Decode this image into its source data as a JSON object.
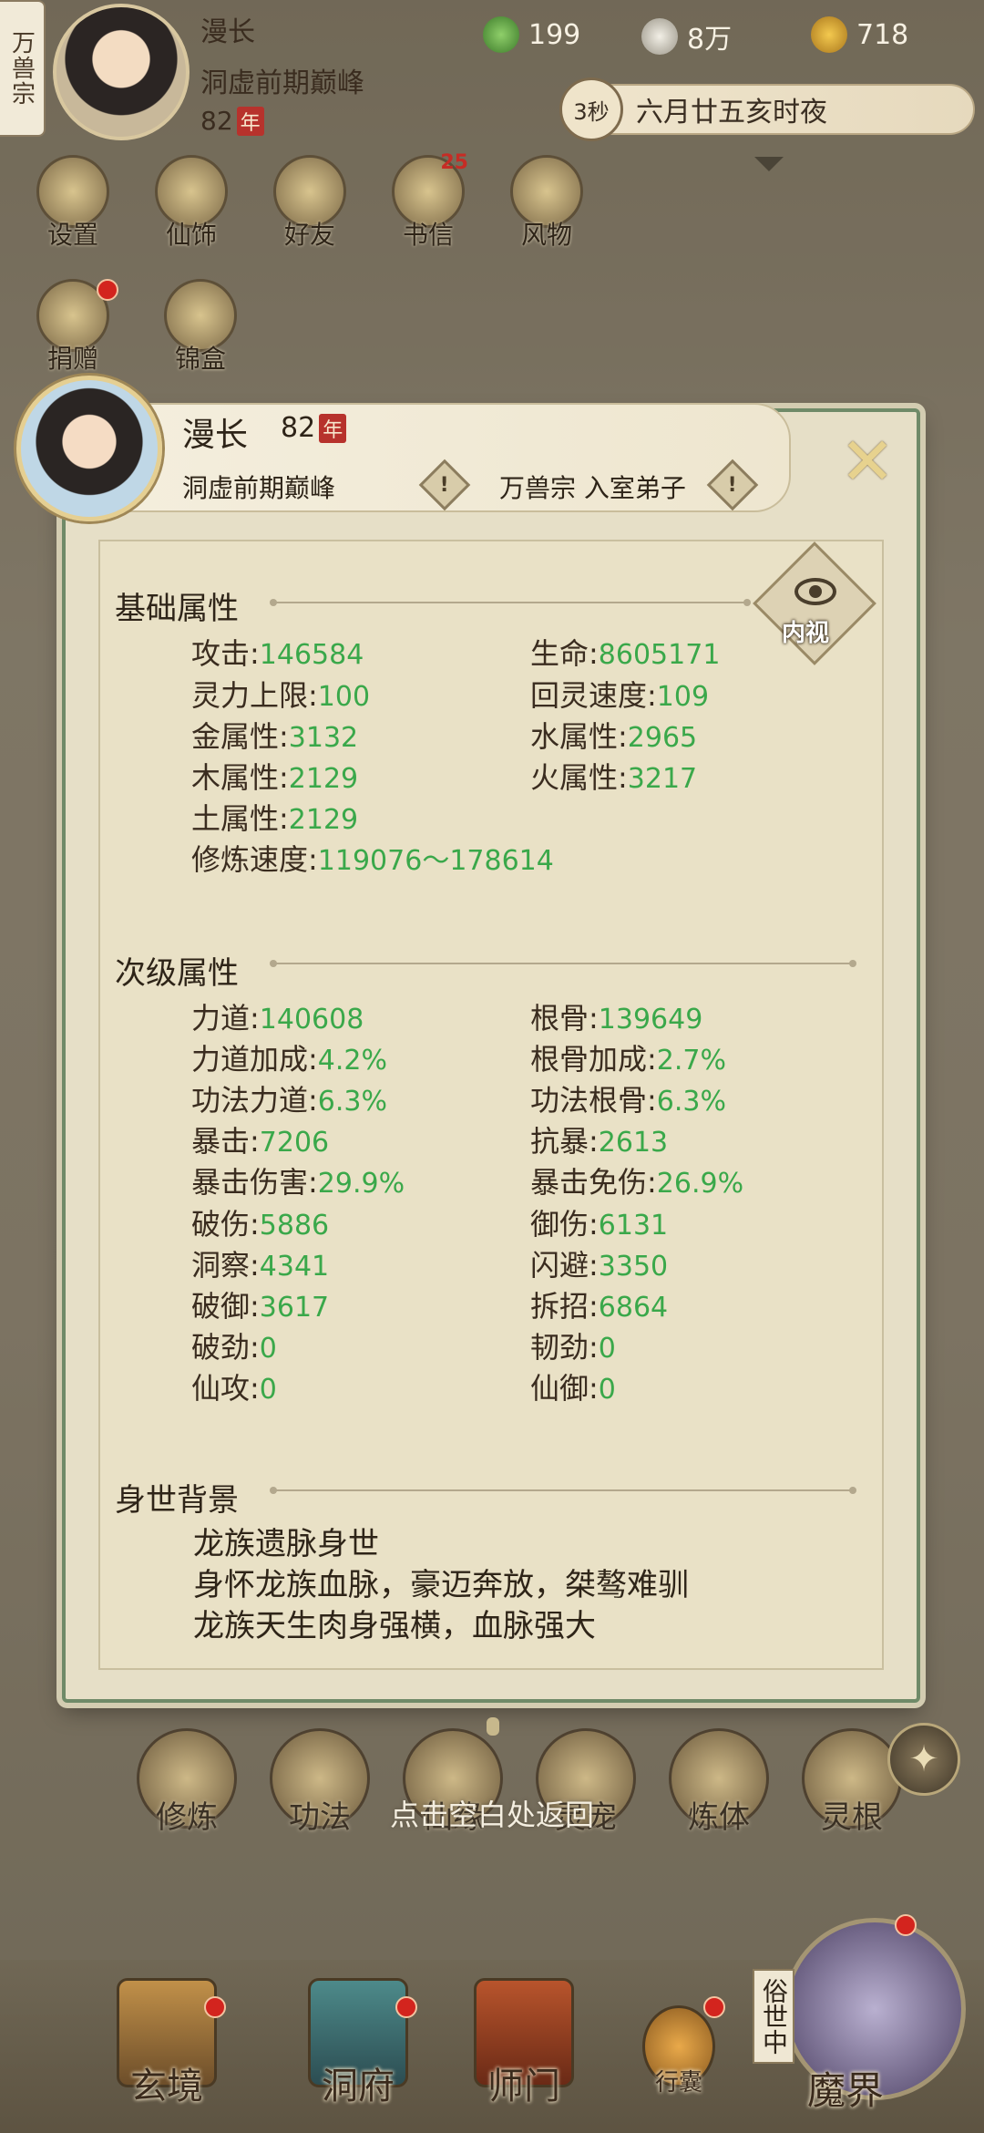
{
  "top": {
    "sect_tab": "万兽宗",
    "player_name": "漫长",
    "realm": "洞虚前期巅峰",
    "age": "82",
    "age_unit": "年",
    "resources": [
      {
        "icon": "leaf-icon",
        "value": "199"
      },
      {
        "icon": "coin-icon",
        "value": "8万"
      },
      {
        "icon": "strength-icon",
        "value": "718"
      }
    ],
    "timer_seconds": "3秒",
    "date_text": "六月廿五亥时夜"
  },
  "quick_menu": [
    {
      "label": "设置",
      "icon": "gear-icon"
    },
    {
      "label": "仙饰",
      "icon": "ornament-icon"
    },
    {
      "label": "好友",
      "icon": "friends-icon"
    },
    {
      "label": "书信",
      "icon": "letter-icon",
      "badge": "25"
    },
    {
      "label": "风物",
      "icon": "scenery-icon"
    }
  ],
  "quick_menu2": [
    {
      "label": "捐赠",
      "icon": "donate-icon"
    },
    {
      "label": "锦盒",
      "icon": "gift-box-icon"
    }
  ],
  "panel": {
    "name": "漫长",
    "age": "82",
    "age_unit": "年",
    "realm": "洞虚前期巅峰",
    "sect_role": "万兽宗 入室弟子",
    "inner_view_label": "内视",
    "basic_title": "基础属性",
    "basic": [
      {
        "label": "攻击",
        "value": "146584"
      },
      {
        "label": "生命",
        "value": "8605171"
      },
      {
        "label": "灵力上限",
        "value": "100"
      },
      {
        "label": "回灵速度",
        "value": "109"
      },
      {
        "label": "金属性",
        "value": "3132"
      },
      {
        "label": "水属性",
        "value": "2965"
      },
      {
        "label": "木属性",
        "value": "2129"
      },
      {
        "label": "火属性",
        "value": "3217"
      },
      {
        "label": "土属性",
        "value": "2129"
      },
      {
        "label": "修炼速度",
        "value": "119076～178614"
      }
    ],
    "secondary_title": "次级属性",
    "secondary": [
      {
        "label": "力道",
        "value": "140608"
      },
      {
        "label": "根骨",
        "value": "139649"
      },
      {
        "label": "力道加成",
        "value": "4.2%"
      },
      {
        "label": "根骨加成",
        "value": "2.7%"
      },
      {
        "label": "功法力道",
        "value": "6.3%"
      },
      {
        "label": "功法根骨",
        "value": "6.3%"
      },
      {
        "label": "暴击",
        "value": "7206"
      },
      {
        "label": "抗暴",
        "value": "2613"
      },
      {
        "label": "暴击伤害",
        "value": "29.9%"
      },
      {
        "label": "暴击免伤",
        "value": "26.9%"
      },
      {
        "label": "破伤",
        "value": "5886"
      },
      {
        "label": "御伤",
        "value": "6131"
      },
      {
        "label": "洞察",
        "value": "4341"
      },
      {
        "label": "闪避",
        "value": "3350"
      },
      {
        "label": "破御",
        "value": "3617"
      },
      {
        "label": "拆招",
        "value": "6864"
      },
      {
        "label": "破劲",
        "value": "0"
      },
      {
        "label": "韧劲",
        "value": "0"
      },
      {
        "label": "仙攻",
        "value": "0"
      },
      {
        "label": "仙御",
        "value": "0"
      }
    ],
    "background_title": "身世背景",
    "background_lines": [
      "龙族遗脉身世",
      "身怀龙族血脉，豪迈奔放，桀骜难驯",
      "龙族天生肉身强横，血脉强大"
    ]
  },
  "bottom_menu": [
    "修炼",
    "功法",
    "仙缘",
    "灵宠",
    "炼体",
    "灵根"
  ],
  "return_tip": "点击空白处返回",
  "nav": {
    "items": [
      {
        "label": "玄境",
        "icon": "realm-icon"
      },
      {
        "label": "洞府",
        "icon": "cave-icon"
      },
      {
        "label": "师门",
        "icon": "sect-icon"
      },
      {
        "label": "行囊",
        "icon": "bag-icon"
      }
    ],
    "secular_tag": "俗世中",
    "demon_label": "魔界"
  }
}
